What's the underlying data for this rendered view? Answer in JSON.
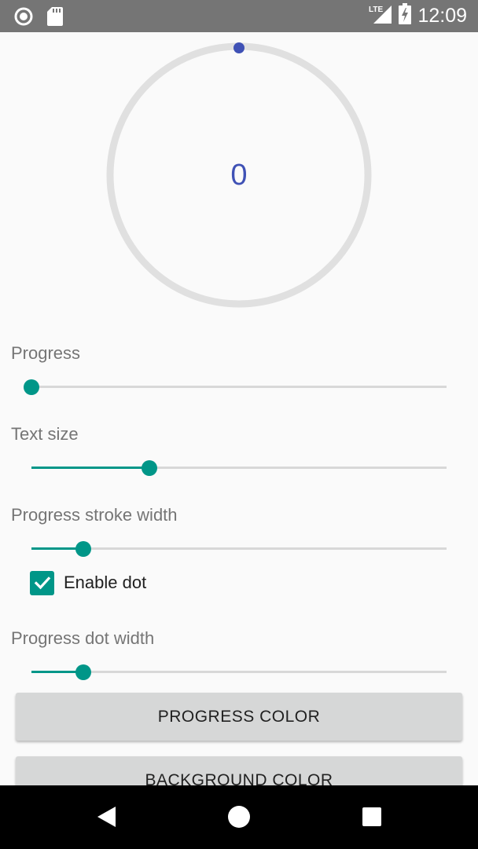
{
  "status_bar": {
    "time": "12:09",
    "network": "LTE",
    "icons": [
      "record-icon",
      "sd-card-icon",
      "lte-signal-icon",
      "battery-charging-icon"
    ]
  },
  "progress_view": {
    "value": "0",
    "progress_fraction": 0,
    "ring_color": "#e0e0e0",
    "progress_color": "#3f51b5"
  },
  "controls": {
    "progress": {
      "label": "Progress",
      "value_fraction": 0.0
    },
    "text_size": {
      "label": "Text size",
      "value_fraction": 0.285
    },
    "stroke_width": {
      "label": "Progress stroke width",
      "value_fraction": 0.125
    },
    "enable_dot": {
      "label": "Enable dot",
      "checked": true
    },
    "dot_width": {
      "label": "Progress dot width",
      "value_fraction": 0.125
    }
  },
  "buttons": {
    "progress_color": "PROGRESS COLOR",
    "background_color": "BACKGROUND COLOR"
  },
  "colors": {
    "accent": "#009688",
    "primary": "#3f51b5",
    "status_bar": "#757575",
    "nav_bar": "#000000"
  },
  "nav_bar": {
    "icons": [
      "back-icon",
      "home-icon",
      "recents-icon"
    ]
  }
}
